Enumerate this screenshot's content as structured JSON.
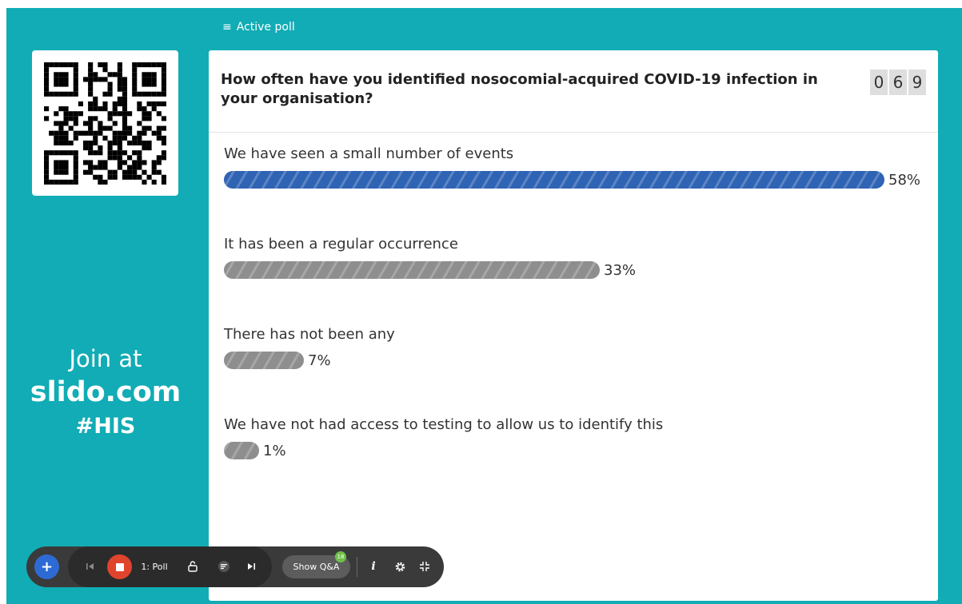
{
  "header": {
    "label": "Active poll",
    "icon": "list-icon"
  },
  "join": {
    "prefix": "Join at",
    "site": "slido.com",
    "code": "#HIS"
  },
  "poll": {
    "question": "How often have you identified nosocomial-acquired COVID-19 infection in your organisation?",
    "counter": [
      "0",
      "6",
      "9"
    ],
    "options": [
      {
        "label": "We have seen a small number of events",
        "percent_label": "58%",
        "value": 58,
        "selected": true
      },
      {
        "label": "It has been a regular occurrence",
        "percent_label": "33%",
        "value": 33,
        "selected": false
      },
      {
        "label": "There has not been any",
        "percent_label": "7%",
        "value": 7,
        "selected": false
      },
      {
        "label": "We have not had access to testing to allow us to identify this",
        "percent_label": "1%",
        "value": 1,
        "selected": false
      }
    ]
  },
  "toolbar": {
    "add_label": "+",
    "poll_label": "1: Poll",
    "show_qa_label": "Show Q&A",
    "qa_badge": "18",
    "info_label": "i"
  },
  "colors": {
    "background": "#11acb5",
    "selected_bar": "#2f63b4",
    "bar": "#8e8e8e",
    "stop": "#e0442d",
    "add": "#2e6ad3"
  }
}
